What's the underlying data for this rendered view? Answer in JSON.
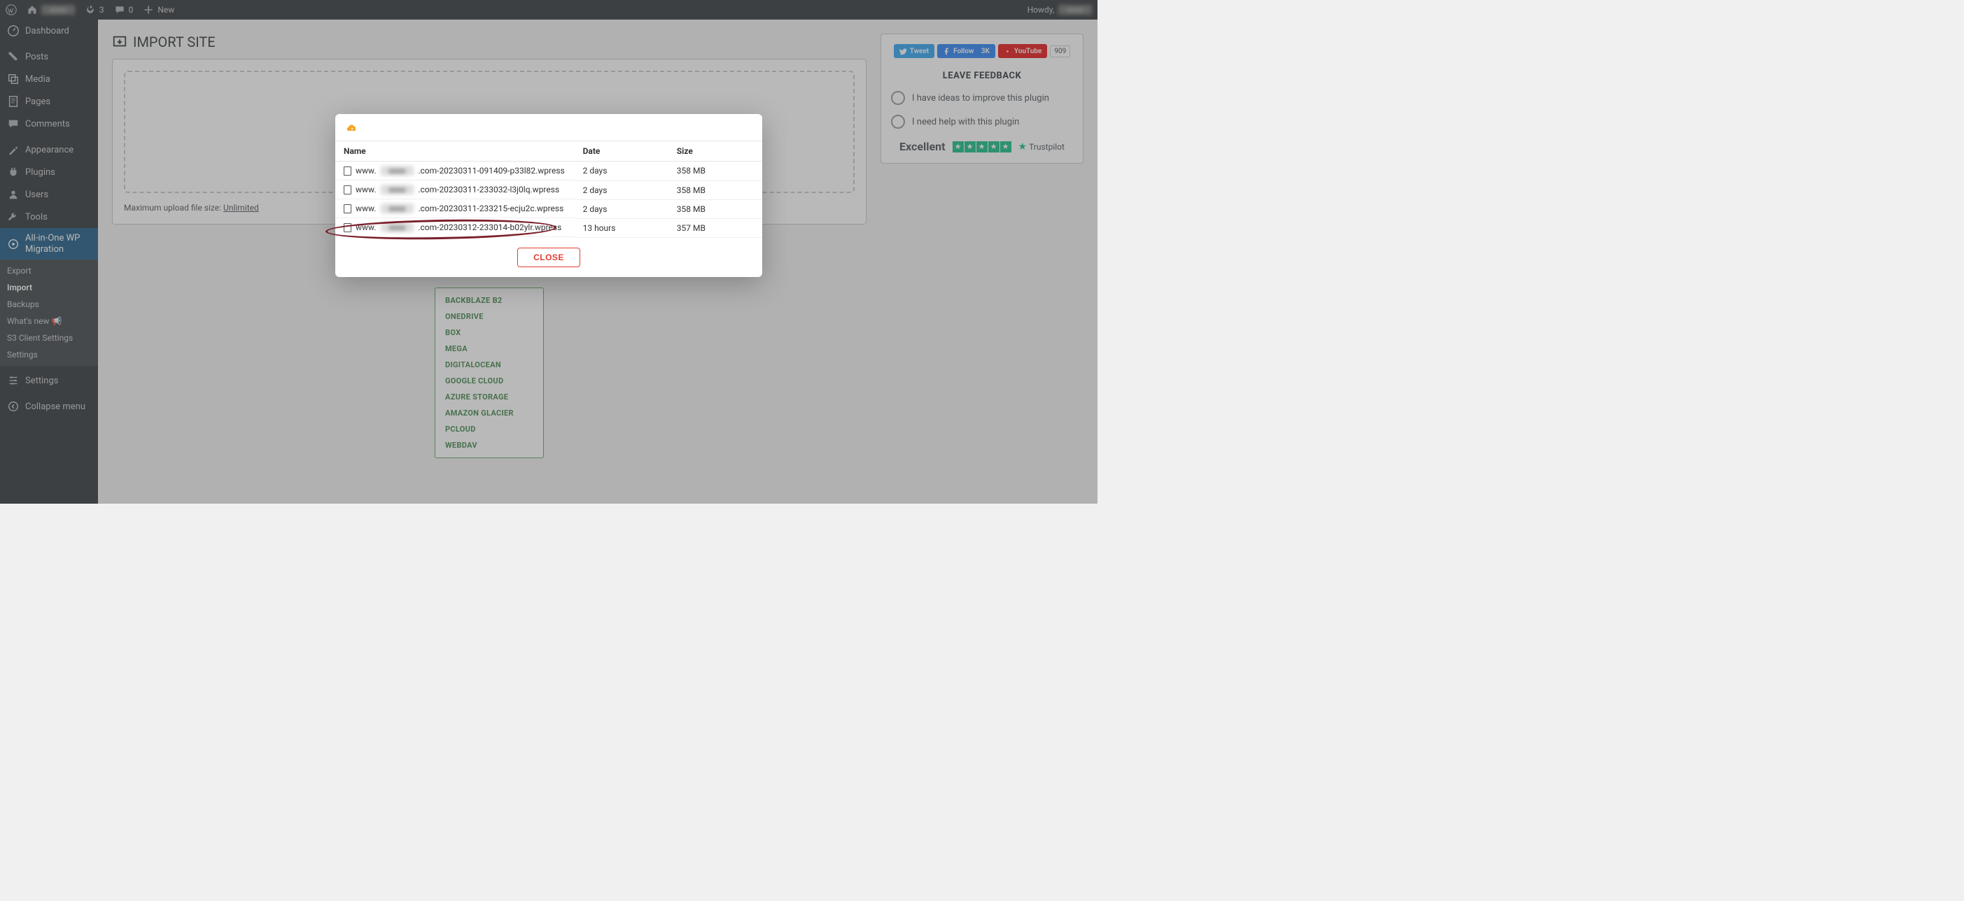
{
  "adminbar": {
    "refresh_count": "3",
    "comments_count": "0",
    "new_label": "New",
    "howdy": "Howdy,"
  },
  "sidebar": {
    "items": [
      {
        "label": "Dashboard",
        "icon": "dashboard"
      },
      {
        "label": "Posts",
        "icon": "pin"
      },
      {
        "label": "Media",
        "icon": "media"
      },
      {
        "label": "Pages",
        "icon": "page"
      },
      {
        "label": "Comments",
        "icon": "comment"
      },
      {
        "label": "Appearance",
        "icon": "brush"
      },
      {
        "label": "Plugins",
        "icon": "plugin"
      },
      {
        "label": "Users",
        "icon": "user"
      },
      {
        "label": "Tools",
        "icon": "wrench"
      },
      {
        "label": "All-in-One WP Migration",
        "icon": "aio"
      },
      {
        "label": "Settings",
        "icon": "sliders"
      },
      {
        "label": "Collapse menu",
        "icon": "collapse"
      }
    ],
    "submenu": [
      {
        "label": "Export"
      },
      {
        "label": "Import",
        "current": true
      },
      {
        "label": "Backups"
      },
      {
        "label": "What's new 📢"
      },
      {
        "label": "S3 Client Settings"
      },
      {
        "label": "Settings"
      }
    ]
  },
  "page": {
    "title": "IMPORT SITE",
    "upload_note_prefix": "Maximum upload file size: ",
    "upload_note_value": "Unlimited"
  },
  "providers": [
    "BACKBLAZE B2",
    "ONEDRIVE",
    "BOX",
    "MEGA",
    "DIGITALOCEAN",
    "GOOGLE CLOUD",
    "AZURE STORAGE",
    "AMAZON GLACIER",
    "PCLOUD",
    "WEBDAV"
  ],
  "feedback": {
    "tweet": "Tweet",
    "follow": "Follow",
    "follow_count": "3K",
    "youtube": "YouTube",
    "youtube_count": "909",
    "title": "LEAVE FEEDBACK",
    "opt1": "I have ideas to improve this plugin",
    "opt2": "I need help with this plugin",
    "excellent": "Excellent",
    "trustpilot": "Trustpilot"
  },
  "modal": {
    "headers": {
      "name": "Name",
      "date": "Date",
      "size": "Size"
    },
    "rows": [
      {
        "pre": "www.",
        "post": ".com-20230311-091409-p33l82.wpress",
        "date": "2 days",
        "size": "358 MB"
      },
      {
        "pre": "www.",
        "post": ".com-20230311-233032-l3j0lq.wpress",
        "date": "2 days",
        "size": "358 MB"
      },
      {
        "pre": "www.",
        "post": ".com-20230311-233215-ecju2c.wpress",
        "date": "2 days",
        "size": "358 MB"
      },
      {
        "pre": "www.",
        "post": ".com-20230312-233014-b02ylr.wpress",
        "date": "13 hours",
        "size": "357 MB"
      }
    ],
    "close": "CLOSE"
  }
}
